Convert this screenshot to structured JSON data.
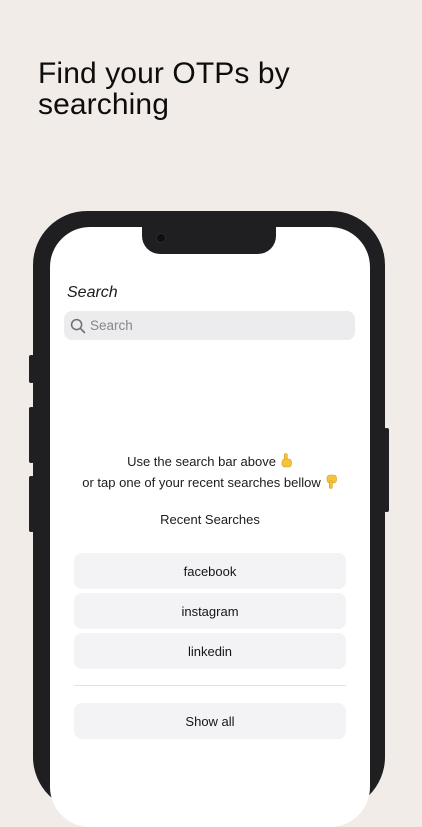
{
  "headline": "Find your OTPs by searching",
  "screen": {
    "title": "Search",
    "search": {
      "placeholder": "Search",
      "value": ""
    },
    "hint_line1": "Use the search bar above",
    "hint_line2": "or tap one of your recent searches bellow",
    "hint_icon_up": "pointing-up-hand-icon",
    "hint_icon_down": "pointing-down-hand-icon",
    "recent_title": "Recent Searches",
    "recent_items": [
      "facebook",
      "instagram",
      "linkedin"
    ],
    "show_all_label": "Show all"
  },
  "colors": {
    "page_background": "#f1ece8",
    "phone_frame": "#1f1f21",
    "pill_background": "#f3f3f6",
    "search_bar_background": "#ececee",
    "emoji_yellow": "#f5c43c"
  }
}
